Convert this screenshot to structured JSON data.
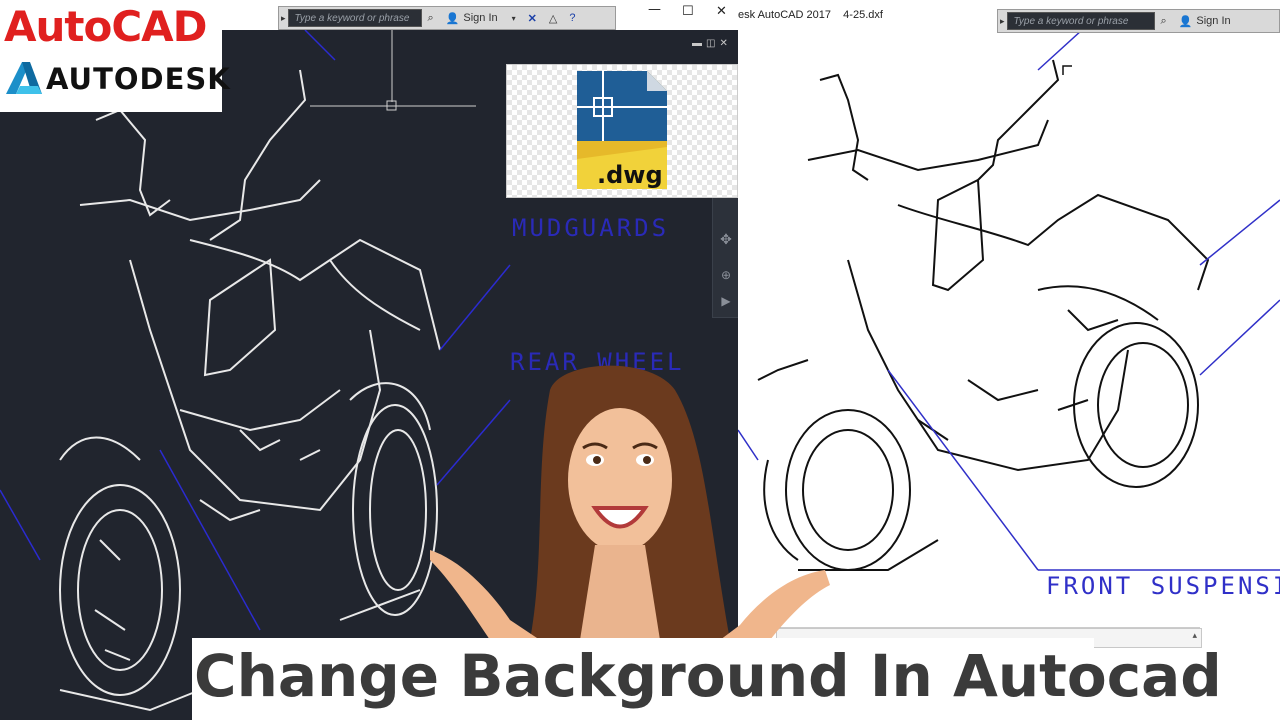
{
  "logo": {
    "brand": "AutoCAD",
    "company": "AUTODESK"
  },
  "left_toolbar": {
    "search_placeholder": "Type a keyword or phrase",
    "sign_in": "Sign In"
  },
  "right_toolbar": {
    "search_placeholder": "Type a keyword or phrase",
    "sign_in": "Sign In"
  },
  "right_window": {
    "title": "esk AutoCAD 2017    4-25.dxf"
  },
  "file_icon": {
    "extension": ".dwg"
  },
  "drawing_labels": {
    "mudguards": "MUDGUARDS",
    "rear_wheel": "REAR WHEEL",
    "front_suspension": "FRONT SUSPENSI"
  },
  "caption": {
    "title": "Change Background In Autocad"
  },
  "colors": {
    "dark_canvas": "#21252e",
    "light_canvas": "#ffffff",
    "autocad_red": "#e0201f",
    "label_blue": "#2a2ab8",
    "caption_text": "#3b3b3b"
  },
  "icons": [
    "binoculars-icon",
    "user-icon",
    "close-icon",
    "help-icon",
    "minimize-icon",
    "maximize-icon"
  ]
}
